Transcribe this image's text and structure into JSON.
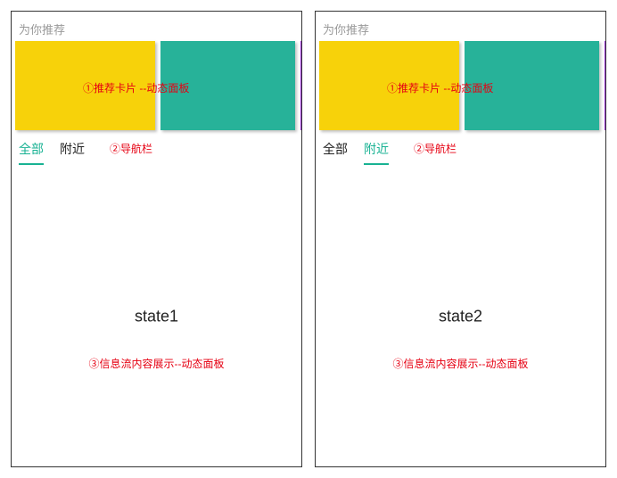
{
  "common": {
    "section_title": "为你推荐",
    "tabs": {
      "all": "全部",
      "nearby": "附近"
    },
    "annot_cards": "①推荐卡片 --动态面板",
    "annot_nav": "②导航栏",
    "annot_feed": "③信息流内容展示--动态面板"
  },
  "states": {
    "state1": {
      "active_tab": "all",
      "label": "state1"
    },
    "state2": {
      "active_tab": "nearby",
      "label": "state2"
    }
  }
}
